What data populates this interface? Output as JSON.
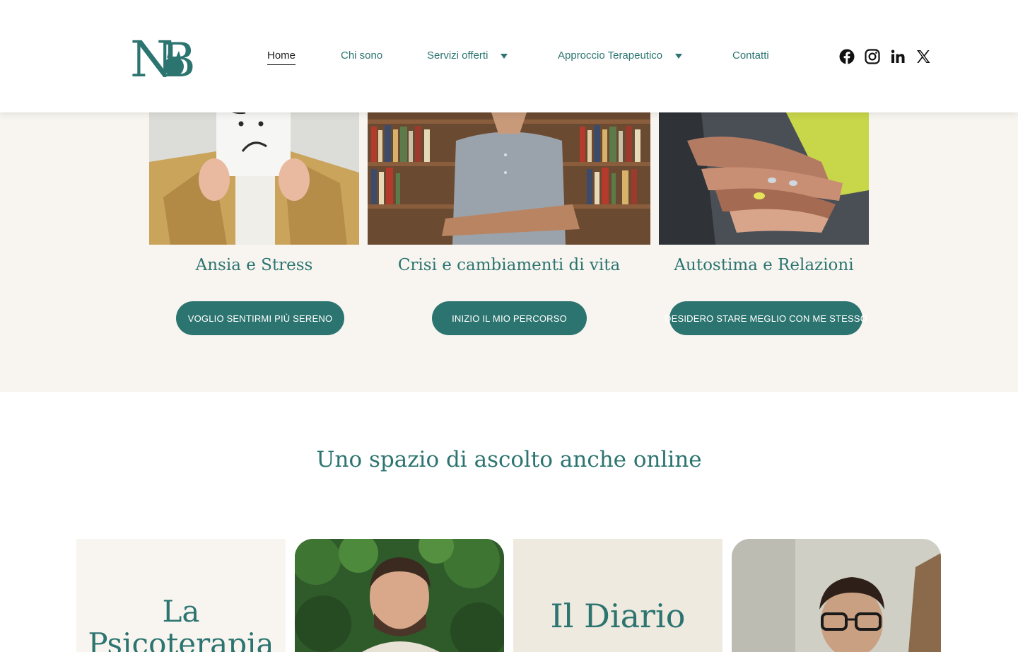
{
  "brand": {
    "logo_text": "NB",
    "color_primary": "#2c7470"
  },
  "nav": {
    "items": [
      {
        "label": "Home"
      },
      {
        "label": "Chi sono"
      },
      {
        "label": "Servizi offerti"
      },
      {
        "label": "Approccio Terapeutico"
      },
      {
        "label": "Contatti"
      }
    ]
  },
  "social": [
    "facebook-icon",
    "instagram-icon",
    "linkedin-icon",
    "x-icon"
  ],
  "services": [
    {
      "title": "Ansia e Stress",
      "cta": "VOGLIO SENTIRMI PIÙ SERENO"
    },
    {
      "title": "Crisi e cambiamenti di vita",
      "cta": "INIZIO IL MIO PERCORSO"
    },
    {
      "title": "Autostima e Relazioni",
      "cta": "DESIDERO STARE MEGLIO CON ME STESSO"
    }
  ],
  "online": {
    "title": "Uno spazio di ascolto anche online",
    "tiles": [
      {
        "text": "La Psicoterapia"
      },
      {
        "text": ""
      },
      {
        "text": "Il Diario"
      },
      {
        "text": ""
      }
    ]
  }
}
